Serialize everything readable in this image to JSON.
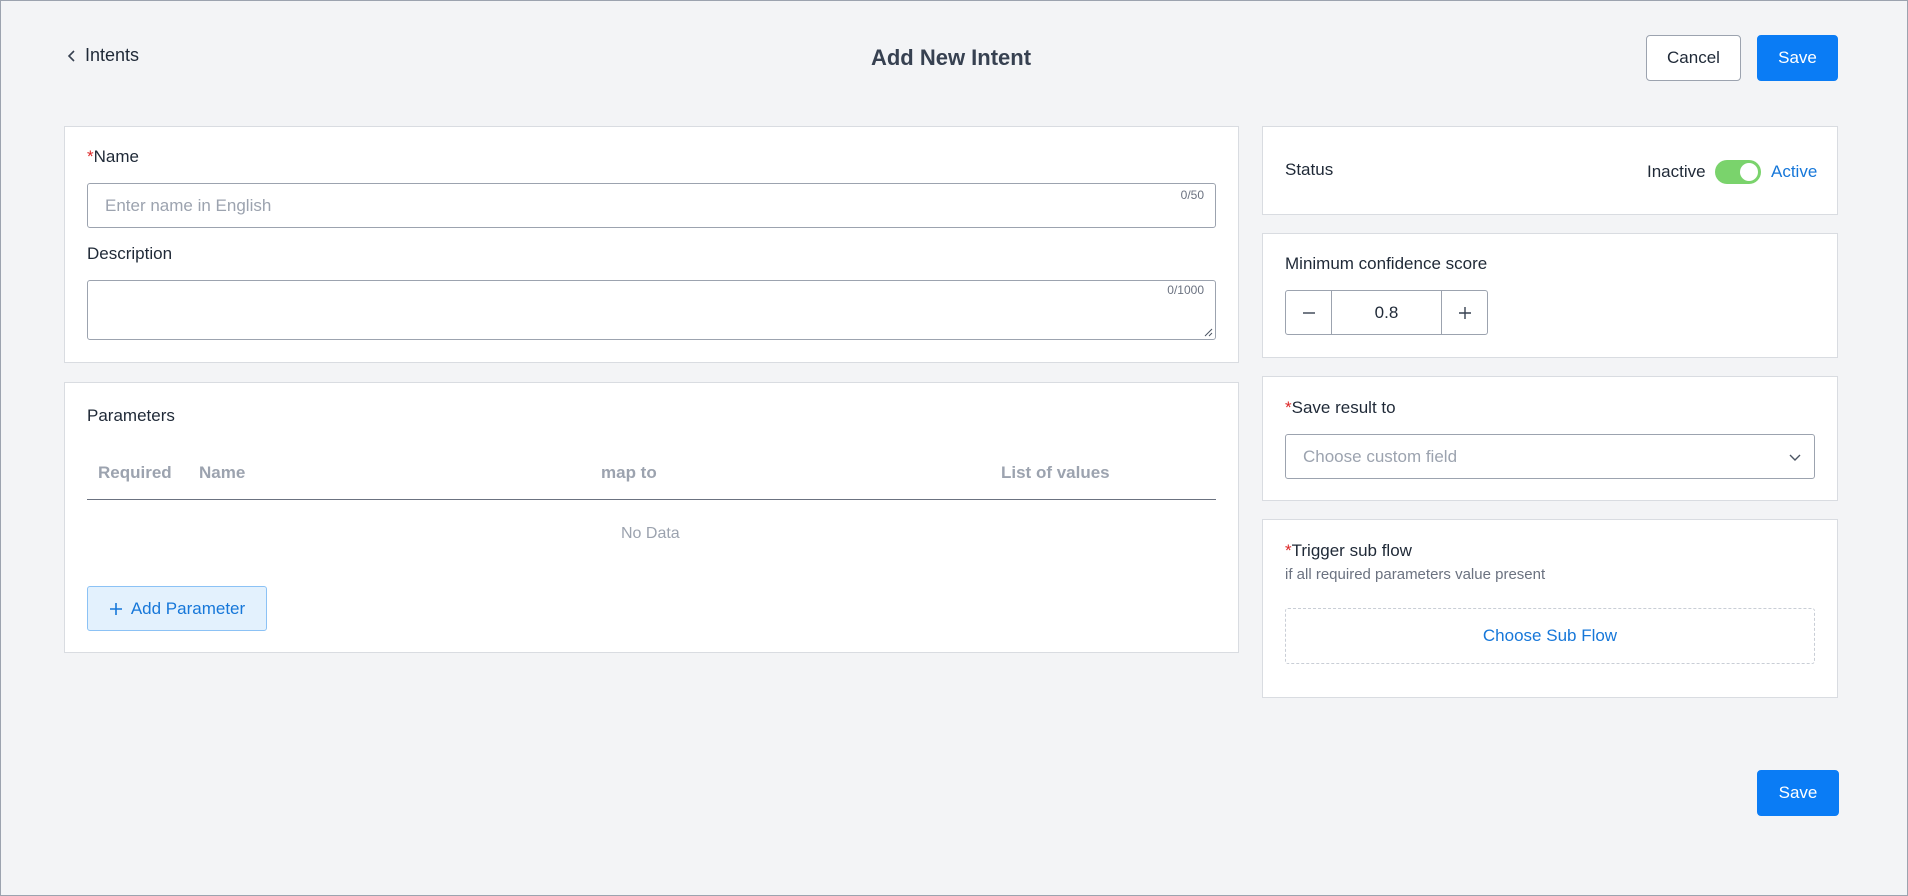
{
  "header": {
    "back_label": "Intents",
    "title": "Add New Intent",
    "cancel_label": "Cancel",
    "save_label": "Save"
  },
  "details": {
    "name_label": "Name",
    "name_placeholder": "Enter name in English",
    "name_counter": "0/50",
    "description_label": "Description",
    "description_counter": "0/1000"
  },
  "parameters": {
    "title": "Parameters",
    "columns": [
      "Required",
      "Name",
      "map to",
      "List of values"
    ],
    "empty_text": "No Data",
    "add_label": "Add Parameter"
  },
  "status": {
    "label": "Status",
    "inactive_label": "Inactive",
    "active_label": "Active",
    "is_active": true
  },
  "confidence": {
    "label": "Minimum confidence score",
    "value": "0.8"
  },
  "save_result": {
    "label": "Save result to",
    "placeholder": "Choose custom field"
  },
  "trigger": {
    "label": "Trigger sub flow",
    "sublabel": "if all required parameters value present",
    "choose_label": "Choose Sub Flow"
  },
  "footer": {
    "save_label": "Save"
  },
  "colors": {
    "primary": "#0a7cf5",
    "required": "#dc2626",
    "toggle_on": "#7ad36c"
  }
}
